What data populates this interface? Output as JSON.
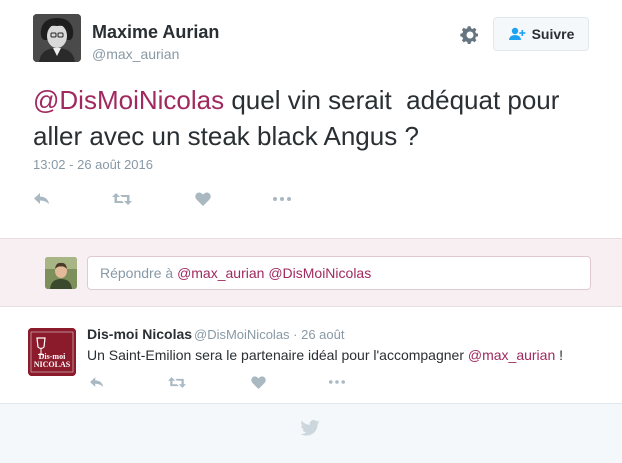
{
  "main_tweet": {
    "author_name": "Maxime Aurian",
    "author_handle": "@max_aurian",
    "follow_label": "Suivre",
    "text_mention": "@DisMoiNicolas",
    "text_body": " quel vin serait  adéquat pour\naller avec un steak black Angus ?",
    "timestamp": "13:02 - 26 août 2016"
  },
  "reply_box": {
    "prefix": "Répondre à ",
    "mentions": "@max_aurian @DisMoiNicolas"
  },
  "reply_tweet": {
    "author_name": "Dis-moi Nicolas",
    "meta": "@DisMoiNicolas · 26 août",
    "text_body": "Un Saint-Emilion sera le partenaire idéal pour l'accompagner ",
    "text_mention": "@max_aurian",
    "text_end": " !",
    "avatar_logo": "Dis-moi NICOLAS"
  },
  "colors": {
    "mention": "#a0295f",
    "icon_gray": "#aab8c2",
    "reply_band": "#f8eff3",
    "nicolas_red": "#8b1a2b"
  },
  "icons": [
    "gear-icon",
    "add-user-icon",
    "reply-icon",
    "retweet-icon",
    "like-icon",
    "more-icon",
    "twitter-bird-icon"
  ]
}
